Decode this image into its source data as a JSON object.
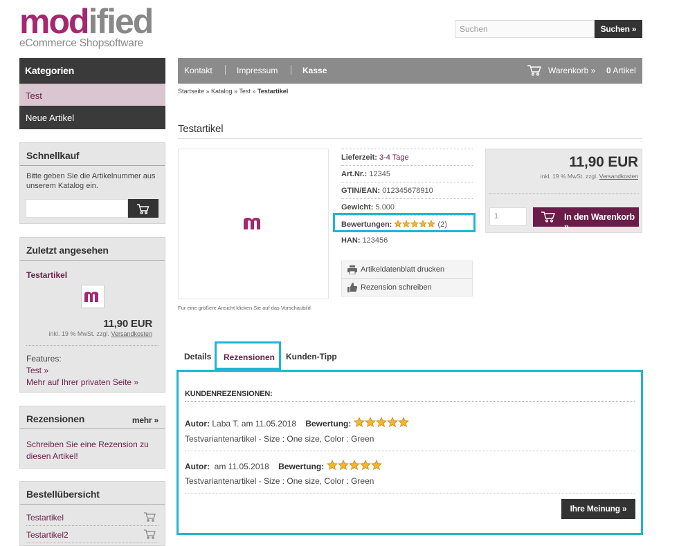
{
  "logo": {
    "word_a": "mod",
    "word_b": "ified",
    "tagline": "eCommerce Shopsoftware"
  },
  "search": {
    "placeholder": "Suchen",
    "button": "Suchen »"
  },
  "sidebar": {
    "categories_title": "Kategorien",
    "categories": [
      "Test",
      "Neue Artikel"
    ],
    "quick": {
      "title": "Schnellkauf",
      "text": "Bitte geben Sie die Artikelnummer aus unserem Katalog ein."
    },
    "recent": {
      "title": "Zuletzt angesehen",
      "product": "Testartikel",
      "price": "11,90 EUR",
      "vat_prefix": "inkl. 19 % MwSt. zzgl.",
      "shipping_link": "Versandkosten",
      "features_label": "Features:",
      "feature_link": "Test »",
      "private_link": "Mehr auf Ihrer privaten Seite »"
    },
    "reviews": {
      "title": "Rezensionen",
      "more": "mehr »",
      "text": "Schreiben Sie eine Rezension zu diesen Artikel!"
    },
    "orders": {
      "title": "Bestellübersicht",
      "items": [
        "Testartikel",
        "Testartikel2"
      ]
    }
  },
  "nav": {
    "items": [
      "Kontakt",
      "Impressum",
      "Kasse"
    ],
    "cart_label": "Warenkorb »",
    "cart_count": "0",
    "cart_unit": "Artikel"
  },
  "breadcrumb": {
    "path": "Startseite » Katalog » Test » ",
    "current": "Testartikel"
  },
  "product": {
    "title": "Testartikel",
    "image_hint": "Fur eine größere Ansicht klicken Sie auf das Vorschaubild",
    "info": [
      {
        "label": "Lieferzeit:",
        "value": "3-4 Tage"
      },
      {
        "label": "Art.Nr.:",
        "value": "12345"
      },
      {
        "label": "GTIN/EAN:",
        "value": "012345678910"
      },
      {
        "label": "Gewicht:",
        "value": "5.000"
      },
      {
        "label": "Bewertungen:",
        "value": "(2)"
      },
      {
        "label": "HAN:",
        "value": "123456"
      }
    ],
    "rating_stars": 5,
    "actions": [
      "Artikeldatenblatt drucken",
      "Rezension schreiben"
    ],
    "price": "11,90 EUR",
    "vat_prefix": "inkl. 19 % MwSt. zzgl.",
    "shipping_link": "Versandkosten",
    "qty": "1",
    "add_to_cart": "In den Warenkorb »"
  },
  "tabs": [
    "Details",
    "Rezensionen",
    "Kunden-Tipp"
  ],
  "reviews_panel": {
    "heading": "KUNDENREZENSIONEN:",
    "author_label": "Autor:",
    "rating_label": "Bewertung:",
    "items": [
      {
        "author_date": "Laba T. am 11.05.2018",
        "stars": 5,
        "text": "Testvariantenartikel - Size : One size, Color : Green"
      },
      {
        "author_date": "am 11.05.2018",
        "stars": 5,
        "text": "Testvariantenartikel - Size : One size, Color : Green"
      }
    ],
    "button": "Ihre Meinung »"
  },
  "colors": {
    "brand": "#a3286f",
    "dark": "#333333",
    "highlight": "#21b5d4",
    "nav": "#8b8b8b"
  }
}
